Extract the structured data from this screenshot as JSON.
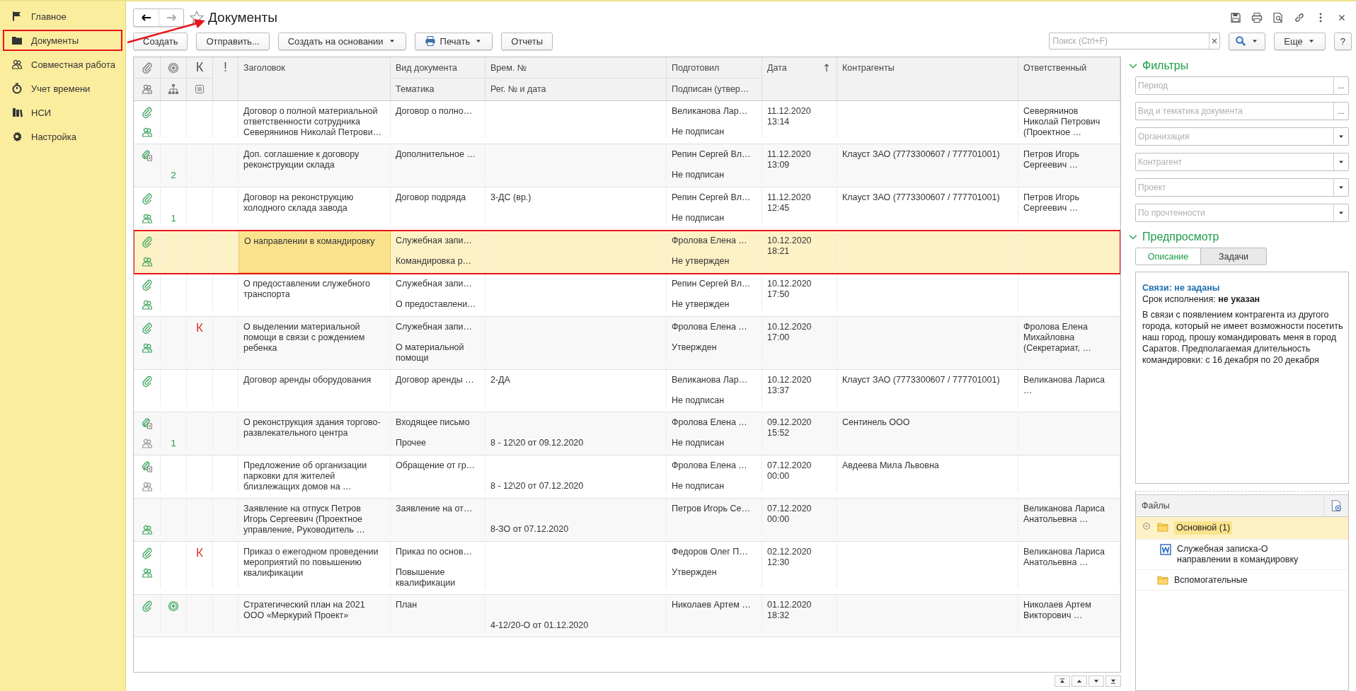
{
  "sidebar": {
    "items": [
      {
        "label": "Главное",
        "selected": false
      },
      {
        "label": "Документы",
        "selected": true
      },
      {
        "label": "Совместная работа",
        "selected": false
      },
      {
        "label": "Учет времени",
        "selected": false
      },
      {
        "label": "НСИ",
        "selected": false
      },
      {
        "label": "Настройка",
        "selected": false
      }
    ]
  },
  "window": {
    "title": "Документы"
  },
  "toolbar": {
    "buttons": [
      {
        "label": "Создать",
        "kind": "plain"
      },
      {
        "label": "Отправить...",
        "kind": "plain"
      },
      {
        "label": "Создать на основании",
        "kind": "menu"
      },
      {
        "label": "Печать",
        "kind": "print_menu"
      },
      {
        "label": "Отчеты",
        "kind": "plain"
      }
    ],
    "search": {
      "placeholder": "Поиск (Ctrl+F)"
    },
    "more": "Еще",
    "help": "?"
  },
  "table": {
    "columns": [
      {
        "kind": "icons"
      },
      {
        "kind": "icons"
      },
      {
        "kind": "mark",
        "label": "К"
      },
      {
        "kind": "mark",
        "label": "!"
      },
      {
        "kind": "text",
        "label": "Заголовок",
        "sorted": false
      },
      {
        "kind": "text",
        "label": "Вид документа",
        "sublabel": "Тематика",
        "sorted": false
      },
      {
        "kind": "text",
        "label": "Врем. №",
        "sublabel": "Рег. № и дата",
        "sorted": false
      },
      {
        "kind": "text",
        "label": "Подготовил",
        "sublabel": "Подписан (утвер…",
        "sorted": false
      },
      {
        "kind": "text",
        "label": "Дата",
        "sorted": true
      },
      {
        "kind": "text",
        "label": "Контрагенты",
        "sorted": false
      },
      {
        "kind": "text",
        "label": "Ответственный",
        "sorted": false
      }
    ],
    "rows": [
      {
        "attachment": true,
        "with_document": false,
        "participants": true,
        "participants_active": true,
        "approved": false,
        "title": "Договор о полной материальной ответственности сотрудника Северянинов Николай Петрови…",
        "doc_type": "Договор о полно…",
        "prepared_by": "Великанова Лар…",
        "signature_status": "Не подписан",
        "date": "11.12.2020",
        "time": "13:14",
        "responsible": "Северянинов Николай Петрович (Проектное …",
        "selected": false
      },
      {
        "attachment": true,
        "with_document": true,
        "participants": false,
        "approved": false,
        "count": "2",
        "title": "Доп. соглашение к договору реконструкции склада",
        "doc_type": "Дополнительное …",
        "prepared_by": "Репин Сергей Вл…",
        "signature_status": "Не подписан",
        "date": "11.12.2020",
        "time": "13:09",
        "counterparty": "Клауст ЗАО (7773300607 / 777701001)",
        "responsible": "Петров Игорь Сергеевич …",
        "selected": false
      },
      {
        "attachment": true,
        "with_document": false,
        "participants": true,
        "participants_active": true,
        "approved": false,
        "count": "1",
        "title": "Договор на реконструкцию холодного склада завода",
        "doc_type": "Договор подряда",
        "number": "3-ДС (вр.)",
        "prepared_by": "Репин Сергей Вл…",
        "signature_status": "Не подписан",
        "date": "11.12.2020",
        "time": "12:45",
        "counterparty": "Клауст ЗАО (7773300607 / 777701001)",
        "responsible": "Петров Игорь Сергеевич …",
        "selected": false
      },
      {
        "attachment": true,
        "with_document": false,
        "participants": true,
        "participants_active": true,
        "approved": false,
        "title": "О направлении в командировку",
        "doc_type": "Служебная запи…",
        "topic": "Командировка р…",
        "prepared_by": "Фролова Елена …",
        "signature_status": "Не утвержден",
        "date": "10.12.2020",
        "time": "18:21",
        "selected": true
      },
      {
        "attachment": true,
        "with_document": false,
        "participants": true,
        "participants_active": true,
        "approved": false,
        "title": "О предоставлении служебного транспорта",
        "doc_type": "Служебная запи…",
        "topic": "О предоставлени…",
        "prepared_by": "Репин Сергей Вл…",
        "signature_status": "Не утвержден",
        "date": "10.12.2020",
        "time": "17:50",
        "selected": false
      },
      {
        "attachment": true,
        "with_document": false,
        "participants": true,
        "participants_active": true,
        "approved": false,
        "control_mark": "К",
        "title": "О выделении материальной помощи в связи с рождением ребенка",
        "doc_type": "Служебная запи…",
        "topic": "О материальной помощи",
        "prepared_by": "Фролова Елена …",
        "signature_status": "Утвержден",
        "date": "10.12.2020",
        "time": "17:00",
        "responsible": "Фролова Елена Михайловна (Секретариат, …",
        "selected": false
      },
      {
        "attachment": true,
        "with_document": false,
        "participants": false,
        "approved": false,
        "title": "Договор аренды оборудования",
        "doc_type": "Договор аренды …",
        "number": "2-ДА",
        "prepared_by": "Великанова Лар…",
        "signature_status": "Не подписан",
        "date": "10.12.2020",
        "time": "13:37",
        "counterparty": "Клауст ЗАО (7773300607 / 777701001)",
        "responsible": "Великанова Лариса …",
        "selected": false
      },
      {
        "attachment": true,
        "with_document": true,
        "participants": true,
        "participants_active": false,
        "approved": false,
        "count": "1",
        "title": "О реконструкция здания торгово-развлекательного центра",
        "doc_type": "Входящее письмо",
        "topic": "Прочее",
        "reg_number": "8 - 12\\20 от 09.12.2020",
        "prepared_by": "Фролова Елена …",
        "signature_status": "Не подписан",
        "date": "09.12.2020",
        "time": "15:52",
        "counterparty": "Сентинель ООО",
        "selected": false
      },
      {
        "attachment": true,
        "with_document": true,
        "participants": true,
        "participants_active": false,
        "approved": false,
        "title": "Предложение об организации парковки для жителей близлежащих домов на …",
        "doc_type": "Обращение от гр…",
        "reg_number": "8 - 12\\20 от 07.12.2020",
        "prepared_by": "Фролова Елена …",
        "signature_status": "Не подписан",
        "date": "07.12.2020",
        "time": "00:00",
        "counterparty": "Авдеева Мила Львовна",
        "selected": false
      },
      {
        "attachment": false,
        "participants": true,
        "participants_active": true,
        "approved": false,
        "title": "Заявление на отпуск Петров Игорь Сергеевич (Проектное управление, Руководитель …",
        "doc_type": "Заявление на от…",
        "reg_number": "8-ЗО от 07.12.2020",
        "prepared_by": "Петров Игорь Се…",
        "date": "07.12.2020",
        "time": "00:00",
        "responsible": "Великанова Лариса Анатольевна …",
        "selected": false
      },
      {
        "attachment": true,
        "with_document": false,
        "participants": true,
        "participants_active": true,
        "approved": false,
        "control_mark": "К",
        "title": "Приказ о ежегодном проведении мероприятий по повышению квалификации",
        "doc_type": "Приказ по основ…",
        "topic": "Повышение квалификации",
        "prepared_by": "Федоров Олег П…",
        "signature_status": "Утвержден",
        "date": "02.12.2020",
        "time": "12:30",
        "responsible": "Великанова Лариса Анатольевна …",
        "selected": false
      },
      {
        "attachment": true,
        "with_document": false,
        "participants": false,
        "approved": true,
        "title": "Стратегический план на 2021 ООО «Меркурий Проект»",
        "doc_type": "План",
        "reg_number": "4-12/20-О от 01.12.2020",
        "prepared_by": "Николаев Артем …",
        "date": "01.12.2020",
        "time": "18:32",
        "responsible": "Николаев Артем Викторович …",
        "selected": false
      }
    ]
  },
  "filters": {
    "title": "Фильтры",
    "expanded": true,
    "fields": [
      {
        "placeholder": "Период",
        "kind": "choice",
        "button_label": "..."
      },
      {
        "placeholder": "Вид и тематика документа",
        "kind": "choice",
        "button_label": "..."
      },
      {
        "placeholder": "Организация",
        "kind": "dropdown"
      },
      {
        "placeholder": "Контрагент",
        "kind": "dropdown"
      },
      {
        "placeholder": "Проект",
        "kind": "dropdown"
      },
      {
        "placeholder": "По прочтенности",
        "kind": "dropdown"
      }
    ]
  },
  "preview": {
    "title": "Предпросмотр",
    "expanded": true,
    "tabs": [
      {
        "label": "Описание",
        "selected": true
      },
      {
        "label": "Задачи",
        "selected": false
      }
    ],
    "links": "Связи: не заданы",
    "deadline": "Срок исполнения: **не указан**",
    "text": "В связи с появлением контрагента из другого города, который не имеет возможности посетить наш город, прошу командировать меня в город Саратов. Предполагаемая длительность командировки: с 16 декабря по 20 декабря"
  },
  "files": {
    "title": "Файлы",
    "items": [
      {
        "label": "Основной (1)",
        "kind": "folder",
        "expanded": true,
        "selected": true,
        "children": [
          {
            "label": "Служебная записка-О направлении в командировку",
            "kind": "word"
          }
        ]
      },
      {
        "label": "Вспомогательные",
        "kind": "folder",
        "expanded": false,
        "selected": false
      }
    ]
  }
}
